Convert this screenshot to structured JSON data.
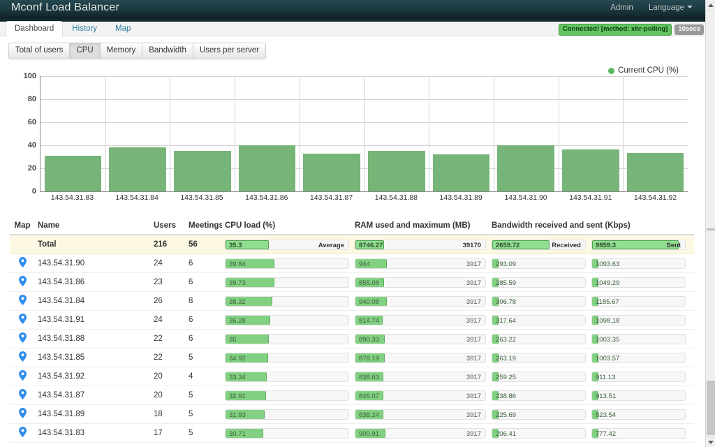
{
  "navbar": {
    "brand": "Mconf Load Balancer",
    "admin_label": "Admin",
    "language_label": "Language"
  },
  "tabs": [
    {
      "label": "Dashboard",
      "active": true
    },
    {
      "label": "History",
      "active": false
    },
    {
      "label": "Map",
      "active": false
    }
  ],
  "connection": {
    "status_text": "Connected! [method: xhr-polling]",
    "interval_text": "10secs",
    "status_color": "#62c462",
    "interval_color": "#999999"
  },
  "metric_buttons": [
    {
      "label": "Total of users",
      "active": false
    },
    {
      "label": "CPU",
      "active": true
    },
    {
      "label": "Memory",
      "active": false
    },
    {
      "label": "Bandwidth",
      "active": false
    },
    {
      "label": "Users per server",
      "active": false
    }
  ],
  "chart_data": {
    "type": "bar",
    "title": "",
    "xlabel": "",
    "ylabel": "",
    "ylim": [
      0,
      100
    ],
    "yticks": [
      0,
      20,
      40,
      60,
      80,
      100
    ],
    "grid": true,
    "legend_position": "top-right",
    "legend": [
      "Current CPU (%)"
    ],
    "series_color": "#76b477",
    "categories": [
      "143.54.31.83",
      "143.54.31.84",
      "143.54.31.85",
      "143.54.31.86",
      "143.54.31.87",
      "143.54.31.88",
      "143.54.31.89",
      "143.54.31.90",
      "143.54.31.91",
      "143.54.31.92"
    ],
    "series": [
      {
        "name": "Current CPU (%)",
        "values": [
          30.71,
          38.32,
          34.92,
          39.73,
          32.91,
          35,
          31.93,
          39.84,
          36.28,
          33.34
        ]
      }
    ]
  },
  "table": {
    "headers": {
      "map": "Map",
      "name": "Name",
      "users": "Users",
      "meetings": "Meetings",
      "cpu": "CPU load (%)",
      "ram": "RAM used and maximum (MB)",
      "bandwidth": "Bandwidth received and sent (Kbps)"
    },
    "total_row": {
      "name": "Total",
      "users": "216",
      "meetings": "56",
      "cpu_value": "35.3",
      "cpu_right": "Average",
      "cpu_pct": 35.3,
      "ram_value": "8746.27",
      "ram_right": "39170",
      "ram_pct": 22.3,
      "recv_value": "2659.72",
      "recv_right": "Received",
      "recv_pct": 62,
      "sent_value": "9859.3",
      "sent_right": "Sent",
      "sent_pct": 93
    },
    "rows": [
      {
        "name": "143.54.31.90",
        "users": "24",
        "meetings": "6",
        "cpu_value": "39.84",
        "cpu_pct": 39.84,
        "ram_value": "944",
        "ram_right": "3917",
        "ram_pct": 24.1,
        "recv_value": "293.09",
        "recv_pct": 7,
        "sent_value": "1093.63",
        "sent_pct": 7
      },
      {
        "name": "143.54.31.86",
        "users": "23",
        "meetings": "6",
        "cpu_value": "39.73",
        "cpu_pct": 39.73,
        "ram_value": "855.08",
        "ram_right": "3917",
        "ram_pct": 21.8,
        "recv_value": "285.59",
        "recv_pct": 7,
        "sent_value": "1049.29",
        "sent_pct": 7
      },
      {
        "name": "143.54.31.84",
        "users": "26",
        "meetings": "8",
        "cpu_value": "38.32",
        "cpu_pct": 38.32,
        "ram_value": "940.08",
        "ram_right": "3917",
        "ram_pct": 24.0,
        "recv_value": "306.78",
        "recv_pct": 7,
        "sent_value": "1185.67",
        "sent_pct": 7
      },
      {
        "name": "143.54.31.91",
        "users": "24",
        "meetings": "6",
        "cpu_value": "36.28",
        "cpu_pct": 36.28,
        "ram_value": "814.74",
        "ram_right": "3917",
        "ram_pct": 20.8,
        "recv_value": "317.64",
        "recv_pct": 7,
        "sent_value": "1098.18",
        "sent_pct": 7
      },
      {
        "name": "143.54.31.88",
        "users": "22",
        "meetings": "6",
        "cpu_value": "35",
        "cpu_pct": 35.0,
        "ram_value": "890.33",
        "ram_right": "3917",
        "ram_pct": 22.7,
        "recv_value": "263.22",
        "recv_pct": 7,
        "sent_value": "1003.35",
        "sent_pct": 7
      },
      {
        "name": "143.54.31.85",
        "users": "22",
        "meetings": "5",
        "cpu_value": "34.92",
        "cpu_pct": 34.92,
        "ram_value": "878.19",
        "ram_right": "3917",
        "ram_pct": 22.4,
        "recv_value": "263.19",
        "recv_pct": 7,
        "sent_value": "1003.57",
        "sent_pct": 7
      },
      {
        "name": "143.54.31.92",
        "users": "20",
        "meetings": "4",
        "cpu_value": "33.34",
        "cpu_pct": 33.34,
        "ram_value": "838.63",
        "ram_right": "3917",
        "ram_pct": 21.4,
        "recv_value": "259.25",
        "recv_pct": 7,
        "sent_value": "911.13",
        "sent_pct": 7
      },
      {
        "name": "143.54.31.87",
        "users": "20",
        "meetings": "5",
        "cpu_value": "32.91",
        "cpu_pct": 32.91,
        "ram_value": "846.07",
        "ram_right": "3917",
        "ram_pct": 21.6,
        "recv_value": "238.86",
        "recv_pct": 7,
        "sent_value": "913.51",
        "sent_pct": 7
      },
      {
        "name": "143.54.31.89",
        "users": "18",
        "meetings": "5",
        "cpu_value": "31.93",
        "cpu_pct": 31.93,
        "ram_value": "838.24",
        "ram_right": "3917",
        "ram_pct": 21.4,
        "recv_value": "225.69",
        "recv_pct": 7,
        "sent_value": "823.54",
        "sent_pct": 7
      },
      {
        "name": "143.54.31.83",
        "users": "17",
        "meetings": "5",
        "cpu_value": "30.71",
        "cpu_pct": 30.71,
        "ram_value": "900.91",
        "ram_right": "3917",
        "ram_pct": 23.0,
        "recv_value": "206.41",
        "recv_pct": 7,
        "sent_value": "777.42",
        "sent_pct": 7
      }
    ]
  },
  "icons": {
    "map_pin": "map-pin-icon",
    "caret_down": "chevron-down-icon",
    "scroll_up": "scroll-up-arrow-icon",
    "scroll_down": "scroll-down-arrow-icon"
  }
}
